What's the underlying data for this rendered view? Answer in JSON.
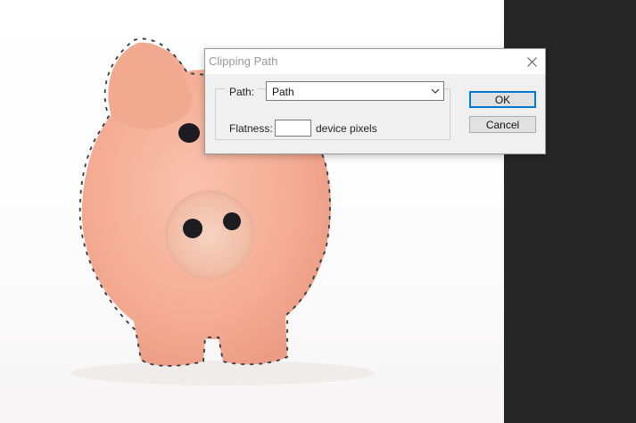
{
  "dialog": {
    "title": "Clipping Path",
    "close_icon": "close-icon",
    "path_label": "Path:",
    "path_selected": "Path",
    "flatness_label": "Flatness:",
    "flatness_value": "",
    "units_label": "device pixels",
    "ok_label": "OK",
    "cancel_label": "Cancel"
  },
  "colors": {
    "accent": "#0078d7",
    "dark_panel": "#262626",
    "pig_body": "#f5b09a"
  }
}
